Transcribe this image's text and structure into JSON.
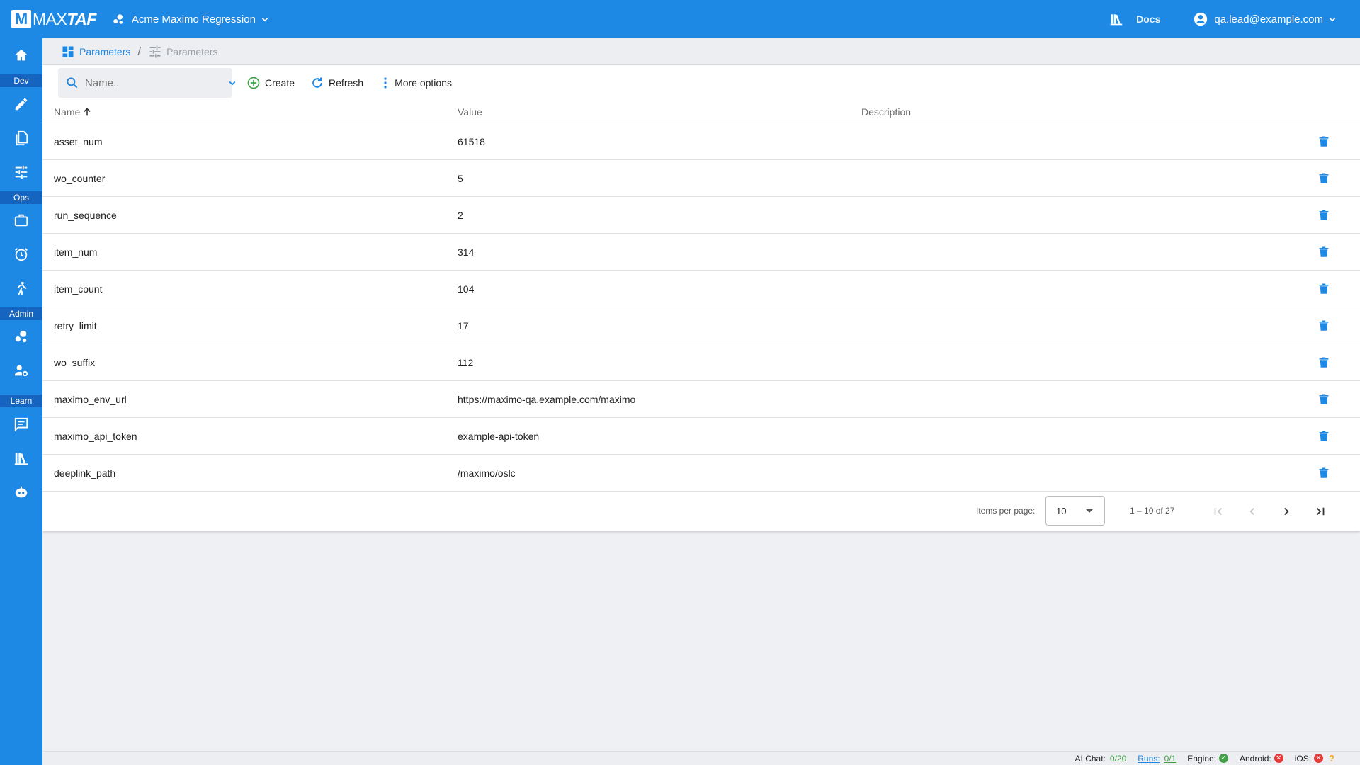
{
  "app": {
    "logo_letter": "M",
    "logo_text_thin": "MAX",
    "logo_text_bold": "TAF",
    "project_name": "Acme Maximo Regression",
    "docs_label": "Docs",
    "user_email": "qa.lead@example.com"
  },
  "sidebar": {
    "sections": {
      "dev": "Dev",
      "ops": "Ops",
      "admin": "Admin",
      "learn": "Learn"
    },
    "icons": [
      "home-icon",
      "pencil-icon",
      "copy-icon",
      "tune-icon",
      "briefcase-icon",
      "alarm-icon",
      "run-icon",
      "bubble-icon",
      "user-cog-icon",
      "chat-icon",
      "library-icon",
      "robot-icon"
    ]
  },
  "breadcrumb": {
    "parent": "Parameters",
    "current": "Parameters"
  },
  "toolbar": {
    "search_placeholder": "Name..",
    "create_label": "Create",
    "refresh_label": "Refresh",
    "more_label": "More options"
  },
  "table": {
    "columns": {
      "name": "Name",
      "value": "Value",
      "description": "Description"
    },
    "rows": [
      {
        "name": "asset_num",
        "value": "61518",
        "description": ""
      },
      {
        "name": "wo_counter",
        "value": "5",
        "description": ""
      },
      {
        "name": "run_sequence",
        "value": "2",
        "description": ""
      },
      {
        "name": "item_num",
        "value": "314",
        "description": ""
      },
      {
        "name": "item_count",
        "value": "104",
        "description": ""
      },
      {
        "name": "retry_limit",
        "value": "17",
        "description": ""
      },
      {
        "name": "wo_suffix",
        "value": "112",
        "description": ""
      },
      {
        "name": "maximo_env_url",
        "value": "https://maximo-qa.example.com/maximo",
        "description": ""
      },
      {
        "name": "maximo_api_token",
        "value": "example-api-token",
        "description": ""
      },
      {
        "name": "deeplink_path",
        "value": "/maximo/oslc",
        "description": ""
      }
    ]
  },
  "paginator": {
    "items_per_page_label": "Items per page:",
    "page_size": "10",
    "range_label": "1 – 10 of 27"
  },
  "status": {
    "ai_chat_label": "AI Chat:",
    "ai_chat_value": "0/20",
    "runs_label": "Runs:",
    "runs_value": "0/1",
    "engine_label": "Engine:",
    "android_label": "Android:",
    "ios_label": "iOS:",
    "help_glyph": "?"
  },
  "colors": {
    "brand": "#1e88e5",
    "brand_dark": "#1565c0",
    "ok": "#43a047",
    "error": "#e53935",
    "warning": "#f9a825"
  }
}
